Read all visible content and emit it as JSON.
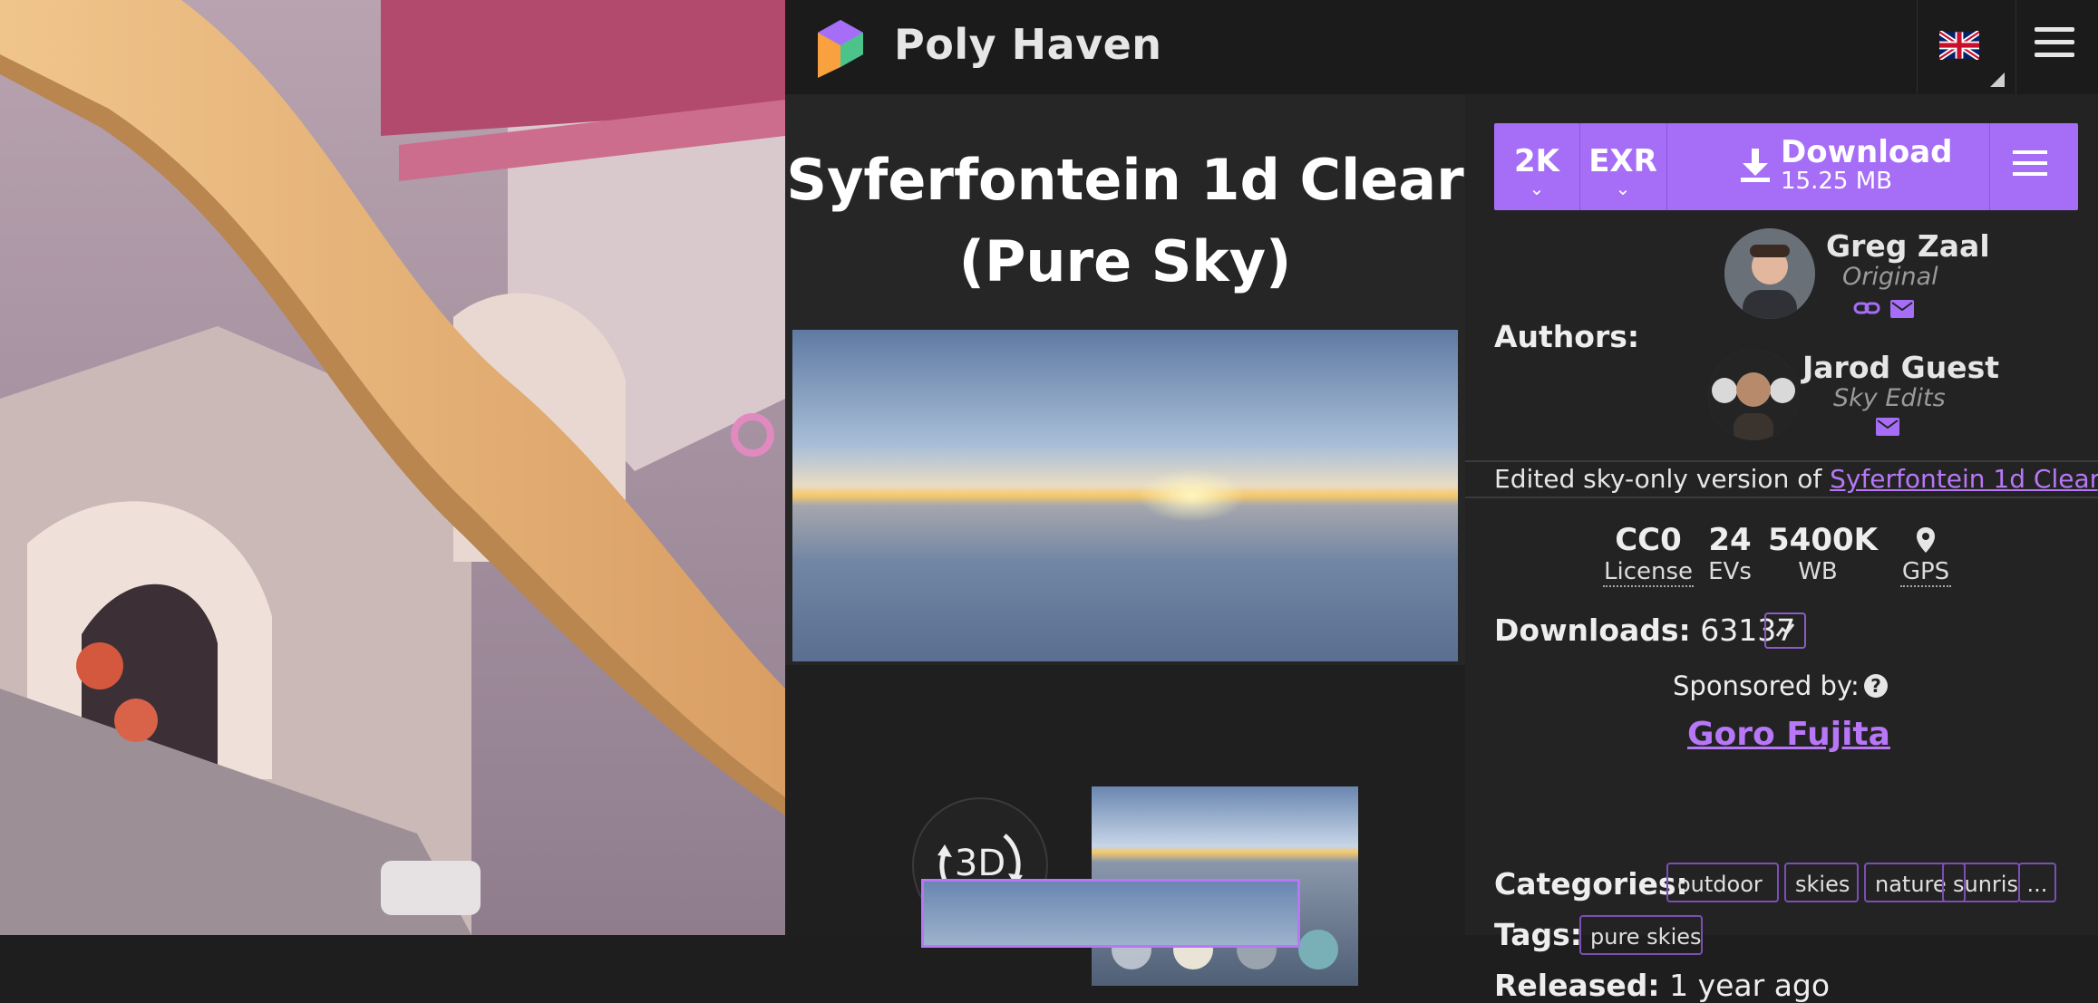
{
  "header": {
    "brand": "Poly Haven"
  },
  "asset": {
    "title_line1": "Syferfontein 1d Clear",
    "title_line2": "(Pure Sky)"
  },
  "viewer": {
    "btn_3d": "3D"
  },
  "download": {
    "resolution": "2K",
    "format": "EXR",
    "label": "Download",
    "size": "15.25 MB"
  },
  "authors": {
    "label": "Authors:",
    "list": [
      {
        "name": "Greg Zaal",
        "role": "Original"
      },
      {
        "name": "Jarod Guest",
        "role": "Sky Edits"
      }
    ]
  },
  "description": {
    "prefix": "Edited sky-only version of ",
    "link": "Syferfontein 1d Clear",
    "suffix": "."
  },
  "stats": [
    {
      "value": "CC0",
      "key": "License"
    },
    {
      "value": "24",
      "key": "EVs"
    },
    {
      "value": "5400K",
      "key": "WB"
    },
    {
      "value": "",
      "key": "GPS"
    }
  ],
  "downloads": {
    "label": "Downloads:",
    "count": "63137"
  },
  "sponsor": {
    "label": "Sponsored by:",
    "help": "?",
    "name": "Goro Fujita"
  },
  "categories": {
    "label": "Categories:",
    "items": [
      "outdoor",
      "skies",
      "nature",
      "sunris"
    ],
    "more": "..."
  },
  "tags": {
    "label": "Tags:",
    "items": [
      "pure skies"
    ]
  },
  "released": {
    "label": "Released:",
    "value": "1 year ago"
  },
  "colors": {
    "accent": "#a66ef7",
    "link": "#b777f7",
    "panel": "#232323",
    "header": "#1b1b1b"
  },
  "icons": [
    "poly-haven-logo-icon",
    "uk-flag-icon",
    "hamburger-menu-icon",
    "download-icon",
    "link-icon",
    "email-icon",
    "gps-pin-icon",
    "graph-icon",
    "help-icon",
    "rotate-3d-icon"
  ]
}
